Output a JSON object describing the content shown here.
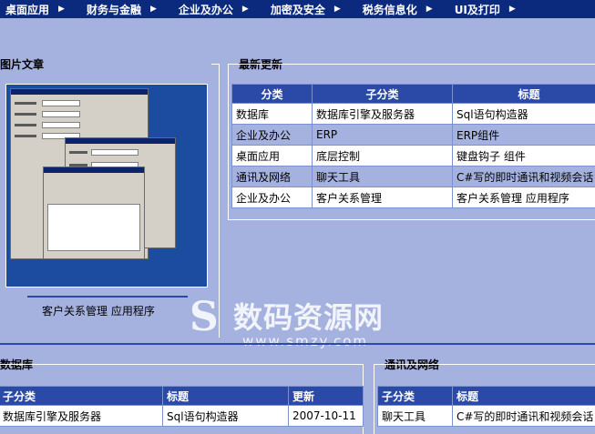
{
  "nav": [
    {
      "label": "桌面应用"
    },
    {
      "label": "财务与金融"
    },
    {
      "label": "企业及办公"
    },
    {
      "label": "加密及安全"
    },
    {
      "label": "税务信息化"
    },
    {
      "label": "UI及打印"
    }
  ],
  "picture_article": {
    "title": "图片文章",
    "caption": "客户关系管理 应用程序"
  },
  "latest": {
    "title": "最新更新",
    "headers": [
      "分类",
      "子分类",
      "标题"
    ],
    "rows": [
      [
        "数据库",
        "数据库引擎及服务器",
        "Sql语句构造器"
      ],
      [
        "企业及办公",
        "ERP",
        "ERP组件"
      ],
      [
        "桌面应用",
        "底层控制",
        "键盘钩子 组件"
      ],
      [
        "通讯及网络",
        "聊天工具",
        "C#写的即时通讯和视频会话"
      ],
      [
        "企业及办公",
        "客户关系管理",
        "客户关系管理 应用程序"
      ]
    ]
  },
  "database": {
    "title": "数据库",
    "headers": [
      "子分类",
      "标题",
      "更新"
    ],
    "rows": [
      [
        "数据库引擎及服务器",
        "Sql语句构造器",
        "2007-10-11"
      ]
    ]
  },
  "network": {
    "title": "通讯及网络",
    "headers": [
      "子分类",
      "标题"
    ],
    "rows": [
      [
        "聊天工具",
        "C#写的即时通讯和视频会话"
      ]
    ]
  },
  "watermark": {
    "text": "数码资源网",
    "url": "www.smzy.com"
  }
}
